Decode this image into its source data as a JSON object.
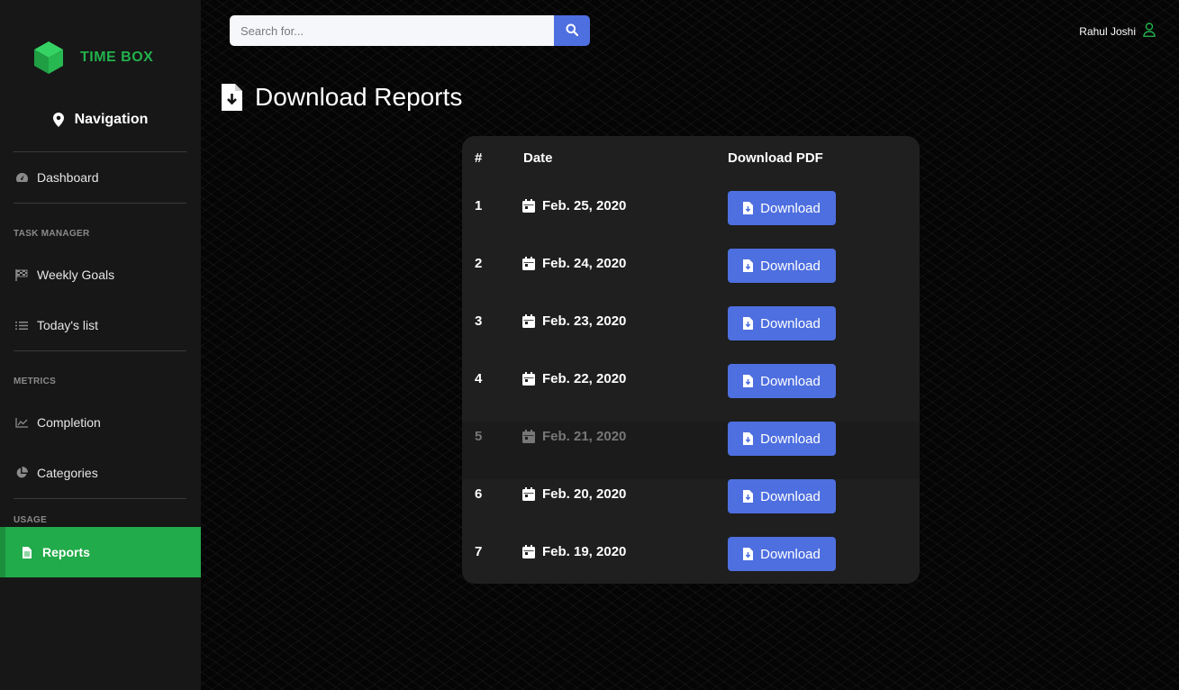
{
  "brand": {
    "name": "TIME BOX",
    "accent": "#22b24c"
  },
  "sidebar": {
    "heading": "Navigation",
    "sections": {
      "task_manager": "TASK MANAGER",
      "metrics": "METRICS",
      "usage": "USAGE"
    },
    "items": [
      {
        "label": "Dashboard",
        "icon": "tachometer-icon"
      },
      {
        "label": "Weekly Goals",
        "icon": "flag-checkered-icon"
      },
      {
        "label": "Today's list",
        "icon": "list-icon"
      },
      {
        "label": "Completion",
        "icon": "line-chart-icon"
      },
      {
        "label": "Categories",
        "icon": "pie-chart-icon"
      },
      {
        "label": "Reports",
        "icon": "file-icon",
        "active": true
      }
    ]
  },
  "search": {
    "placeholder": "Search for...",
    "button_icon": "search-icon"
  },
  "user": {
    "name": "Rahul Joshi",
    "icon": "user-icon"
  },
  "page": {
    "title": "Download Reports",
    "icon": "file-download-icon"
  },
  "table": {
    "headers": {
      "num": "#",
      "date": "Date",
      "download": "Download PDF"
    },
    "rows": [
      {
        "num": "1",
        "date": "Feb. 25, 2020",
        "button": "Download"
      },
      {
        "num": "2",
        "date": "Feb. 24, 2020",
        "button": "Download"
      },
      {
        "num": "3",
        "date": "Feb. 23, 2020",
        "button": "Download"
      },
      {
        "num": "4",
        "date": "Feb. 22, 2020",
        "button": "Download"
      },
      {
        "num": "5",
        "date": "Feb. 21, 2020",
        "button": "Download"
      },
      {
        "num": "6",
        "date": "Feb. 20, 2020",
        "button": "Download"
      },
      {
        "num": "7",
        "date": "Feb. 19, 2020",
        "button": "Download"
      }
    ]
  },
  "colors": {
    "primary_button": "#4e6fe0",
    "active_nav": "#22ab4a",
    "sidebar_bg": "#171717",
    "card_bg": "#1e1f1e"
  }
}
